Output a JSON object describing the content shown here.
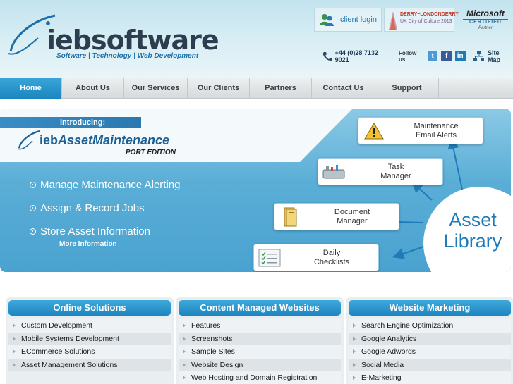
{
  "brand": {
    "name": "iebsoftware",
    "tagline": "Software | Technology | Web Development"
  },
  "header": {
    "client_login": "client login",
    "city_badge_line1": "DERRY~LONDONDERRY",
    "city_badge_line2": "UK City of Culture 2013",
    "ms_line1": "Microsoft",
    "ms_line2": "CERTIFIED",
    "ms_line3": "Partner",
    "phone": "+44 (0)28 7132 9021",
    "follow_us": "Follow us",
    "twitter_glyph": "t",
    "facebook_glyph": "f",
    "linkedin_glyph": "in",
    "site_map": "Site Map"
  },
  "nav": {
    "items": [
      {
        "label": "Home"
      },
      {
        "label": "About Us"
      },
      {
        "label": "Our Services"
      },
      {
        "label": "Our Clients"
      },
      {
        "label": "Partners"
      },
      {
        "label": "Contact Us"
      },
      {
        "label": "Support"
      }
    ]
  },
  "banner": {
    "introducing": "introducing:",
    "product_prefix": "ieb",
    "product_main": "AssetMaintenance",
    "edition": "PORT EDITION",
    "bullets": [
      "Manage Maintenance Alerting",
      "Assign & Record Jobs",
      "Store Asset Information"
    ],
    "more_info": "More Information",
    "callouts": [
      {
        "line1": "Maintenance",
        "line2": "Email Alerts"
      },
      {
        "line1": "Task",
        "line2": "Manager"
      },
      {
        "line1": "Document",
        "line2": "Manager"
      },
      {
        "line1": "Daily",
        "line2": "Checklists"
      }
    ],
    "asset_library": "Asset Library"
  },
  "columns": [
    {
      "title": "Online Solutions",
      "items": [
        "Custom Development",
        "Mobile Systems Development",
        "ECommerce Solutions",
        "Asset Management Solutions"
      ]
    },
    {
      "title": "Content Managed Websites",
      "items": [
        "Features",
        "Screenshots",
        "Sample Sites",
        "Website Design",
        "Web Hosting and Domain Registration"
      ]
    },
    {
      "title": "Website Marketing",
      "items": [
        "Search Engine Optimization",
        "Google Analytics",
        "Google Adwords",
        "Social Media",
        "E-Marketing"
      ]
    }
  ],
  "colors": {
    "accent": "#1e85c0",
    "nav_bg": "#d6dadc",
    "banner_blue": "#5aaed6"
  }
}
